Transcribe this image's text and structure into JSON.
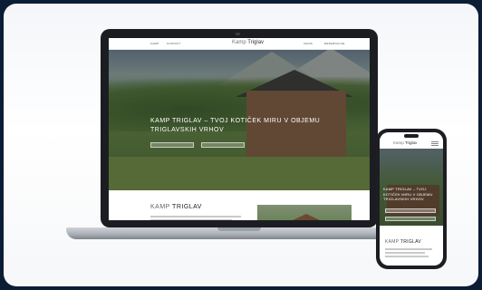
{
  "site": {
    "logo_prefix": "Kamp",
    "logo_name": "Triglav",
    "nav_left": [
      "KAMP",
      "KONTAKT"
    ],
    "nav_right": [
      "CENIK",
      "REZERVACIJE"
    ],
    "hero_title": "KAMP TRIGLAV – TVOJ KOTIČEK MIRU V OBJEMU TRIGLAVSKIH VRHOV",
    "about_prefix": "KAMP",
    "about_name": "TRIGLAV"
  },
  "colors": {
    "background": "#0b1c35",
    "device_frame": "#1b1d22",
    "hero_overlay_text": "#ffffff"
  }
}
